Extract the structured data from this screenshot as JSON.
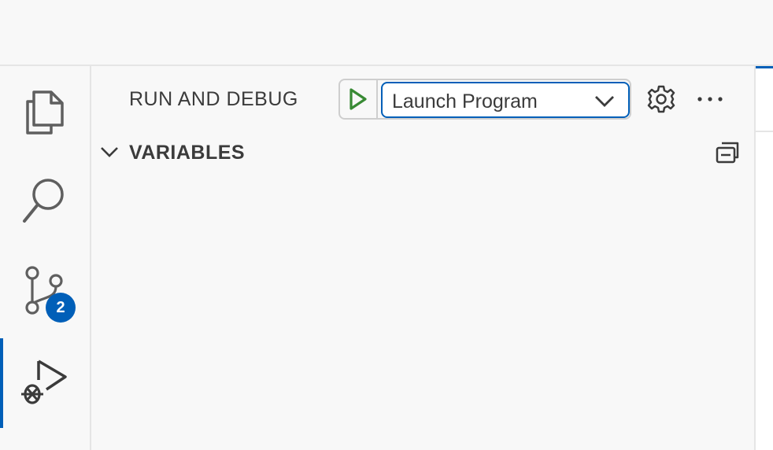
{
  "activity_bar": {
    "items": [
      {
        "name": "explorer",
        "icon": "files-icon"
      },
      {
        "name": "search",
        "icon": "search-icon"
      },
      {
        "name": "source-control",
        "icon": "source-control-icon",
        "badge": "2"
      },
      {
        "name": "run-and-debug",
        "icon": "debug-alt-icon",
        "active": true
      }
    ]
  },
  "sidebar": {
    "title": "RUN AND DEBUG",
    "config": {
      "start_icon": "play-icon",
      "selected": "Launch Program",
      "dropdown_icon": "chevron-down-icon"
    },
    "actions": {
      "settings_icon": "gear-icon",
      "more_icon": "ellipsis-icon"
    },
    "sections": [
      {
        "title": "VARIABLES",
        "expanded": true,
        "action_icon": "collapse-all-icon"
      }
    ]
  },
  "colors": {
    "accent": "#005fb8",
    "play": "#388a34",
    "text": "#3b3b3b",
    "background": "#f8f8f8",
    "border": "#e5e5e5"
  }
}
